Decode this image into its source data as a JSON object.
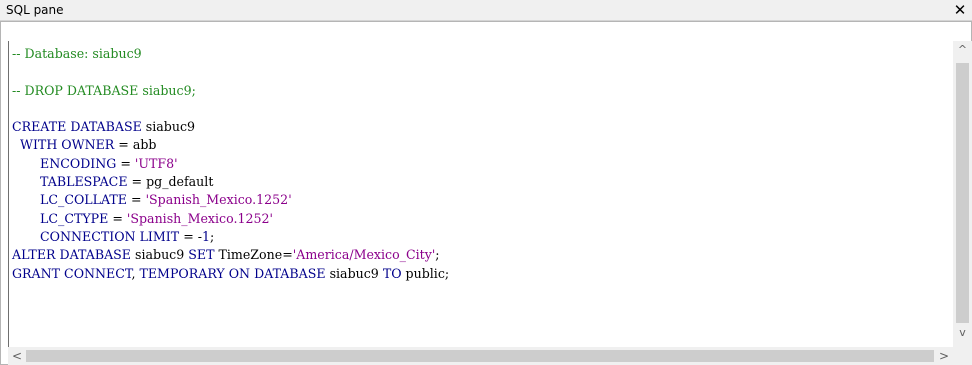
{
  "pane": {
    "title": "SQL pane",
    "close_glyph": "✕"
  },
  "colors": {
    "comment": "#238b22",
    "keyword": "#00008b",
    "string": "#8b008b",
    "background": "#ffffff",
    "chrome": "#f0f0f0"
  },
  "code": {
    "lines": [
      "-- Database: siabuc9",
      "",
      "-- DROP DATABASE siabuc9;",
      "",
      "CREATE DATABASE siabuc9",
      "  WITH OWNER = abb",
      "       ENCODING = 'UTF8'",
      "       TABLESPACE = pg_default",
      "       LC_COLLATE = 'Spanish_Mexico.1252'",
      "       LC_CTYPE = 'Spanish_Mexico.1252'",
      "       CONNECTION LIMIT = -1;",
      "ALTER DATABASE siabuc9 SET TimeZone='America/Mexico_City';",
      "GRANT CONNECT, TEMPORARY ON DATABASE siabuc9 TO public;"
    ]
  },
  "scrollbars": {
    "up_glyph": "^",
    "down_glyph": "v",
    "left_glyph": "<",
    "right_glyph": ">"
  }
}
